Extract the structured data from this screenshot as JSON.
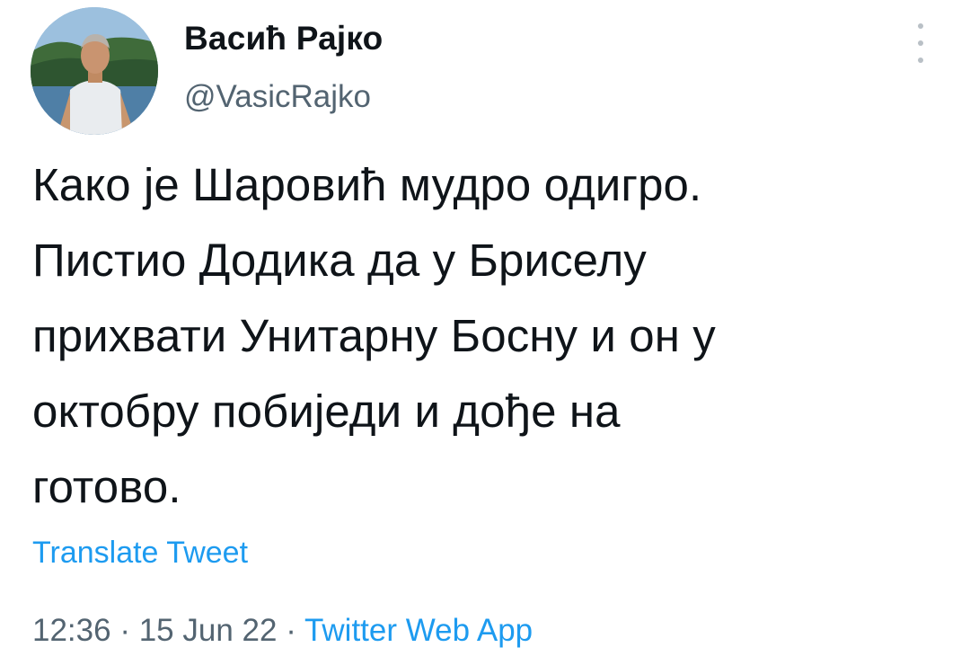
{
  "author": {
    "display_name": "Васић Рајко",
    "handle": "@VasicRajko",
    "avatar_icon": "profile-photo"
  },
  "menu": {
    "more_icon": "more-vertical-icon"
  },
  "tweet": {
    "lines": [
      "Како је Шаровић мудро одигро.",
      "Пистио Додика да у Бриселу",
      "прихвати Унитарну Босну и он у",
      "октобру побиједи и дође на",
      "готово."
    ],
    "translate_label": "Translate Tweet"
  },
  "meta": {
    "time": "12:36",
    "separator": "·",
    "date": "15 Jun 22",
    "source": "Twitter Web App"
  },
  "colors": {
    "text": "#0f1419",
    "secondary": "#536471",
    "link": "#1d9bf0"
  }
}
